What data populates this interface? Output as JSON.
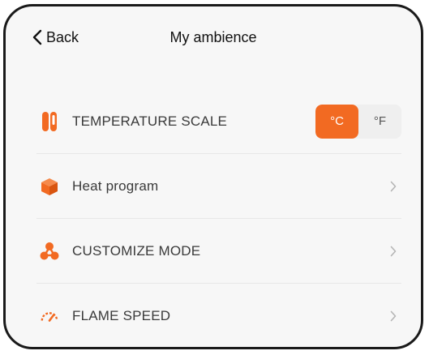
{
  "header": {
    "back_label": "Back",
    "title": "My ambience"
  },
  "accent_color": "#f26a22",
  "rows": [
    {
      "icon": "thermometer-icon",
      "label": "TEMPERATURE SCALE"
    },
    {
      "icon": "box-icon",
      "label": "Heat program"
    },
    {
      "icon": "mode-nodes-icon",
      "label": "CUSTOMIZE MODE"
    },
    {
      "icon": "speedometer-icon",
      "label": "FLAME SPEED"
    }
  ],
  "temperature_scale": {
    "options": [
      "°C",
      "°F"
    ],
    "selected": "°C"
  }
}
